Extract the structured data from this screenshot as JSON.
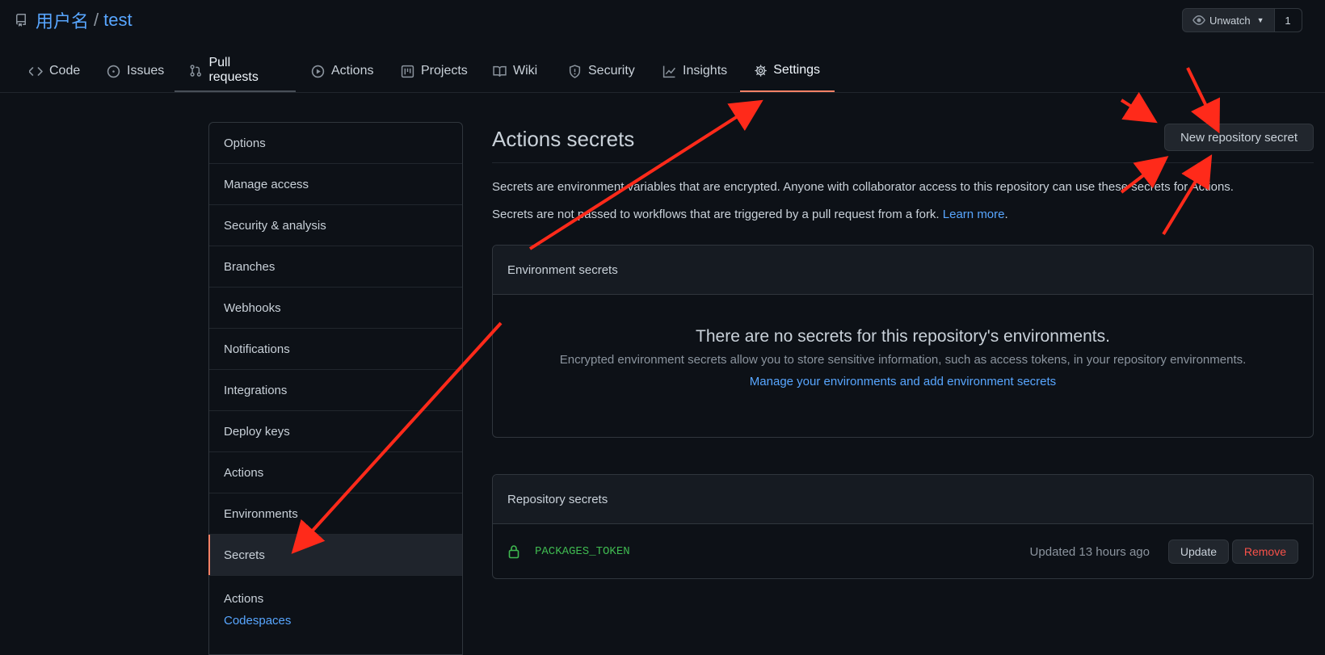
{
  "header": {
    "owner": "用户名",
    "separator": "/",
    "repo": "test",
    "watch_label": "Unwatch",
    "watch_count": "1"
  },
  "tabs": [
    {
      "label": "Code",
      "icon": "code-icon"
    },
    {
      "label": "Issues",
      "icon": "issue-icon"
    },
    {
      "label": "Pull requests",
      "icon": "pull-request-icon"
    },
    {
      "label": "Actions",
      "icon": "play-icon"
    },
    {
      "label": "Projects",
      "icon": "project-icon"
    },
    {
      "label": "Wiki",
      "icon": "book-icon"
    },
    {
      "label": "Security",
      "icon": "shield-icon"
    },
    {
      "label": "Insights",
      "icon": "graph-icon"
    },
    {
      "label": "Settings",
      "icon": "gear-icon"
    }
  ],
  "sidebar": {
    "items": [
      {
        "label": "Options"
      },
      {
        "label": "Manage access"
      },
      {
        "label": "Security & analysis"
      },
      {
        "label": "Branches"
      },
      {
        "label": "Webhooks"
      },
      {
        "label": "Notifications"
      },
      {
        "label": "Integrations"
      },
      {
        "label": "Deploy keys"
      },
      {
        "label": "Actions"
      },
      {
        "label": "Environments"
      },
      {
        "label": "Secrets"
      }
    ],
    "sub_heading": "Actions",
    "sub_link": "Codespaces"
  },
  "main": {
    "title": "Actions secrets",
    "new_secret_button": "New repository secret",
    "desc1": "Secrets are environment variables that are encrypted. Anyone with collaborator access to this repository can use these secrets for Actions.",
    "desc2_prefix": "Secrets are not passed to workflows that are triggered by a pull request from a fork.",
    "desc2_link": "Learn more",
    "desc2_suffix": ".",
    "env_secrets": {
      "heading": "Environment secrets",
      "blank_title": "There are no secrets for this repository's environments.",
      "blank_desc": "Encrypted environment secrets allow you to store sensitive information, such as access tokens, in your repository environments.",
      "blank_link": "Manage your environments and add environment secrets"
    },
    "repo_secrets": {
      "heading": "Repository secrets",
      "rows": [
        {
          "name": "PACKAGES_TOKEN",
          "updated": "Updated 13 hours ago",
          "update_label": "Update",
          "remove_label": "Remove"
        }
      ]
    }
  },
  "colors": {
    "background": "#0d1117",
    "link": "#58a6ff",
    "active_tab_border": "#f78166",
    "secret_name": "#3fb950",
    "danger": "#f85149",
    "annotation_arrow": "#ff2a1a"
  }
}
